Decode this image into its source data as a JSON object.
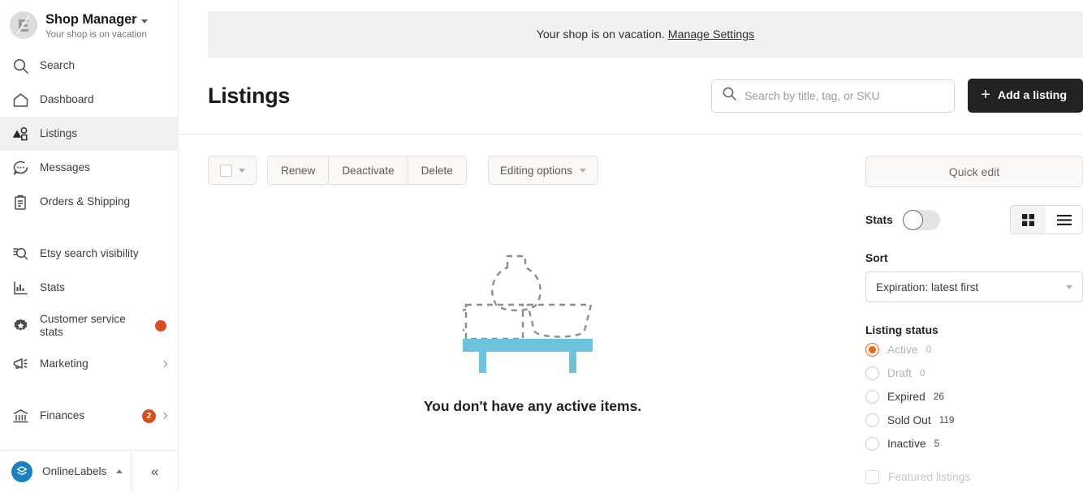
{
  "sidebar": {
    "shop": {
      "title": "Shop Manager",
      "subtitle": "Your shop is on vacation"
    },
    "items": [
      {
        "label": "Search",
        "icon": "search-icon",
        "badge": null,
        "chevron": false
      },
      {
        "label": "Dashboard",
        "icon": "home-icon",
        "badge": null,
        "chevron": false
      },
      {
        "label": "Listings",
        "icon": "listings-icon",
        "badge": null,
        "chevron": false
      },
      {
        "label": "Messages",
        "icon": "message-icon",
        "badge": null,
        "chevron": false
      },
      {
        "label": "Orders & Shipping",
        "icon": "clipboard-icon",
        "badge": null,
        "chevron": false
      },
      {
        "label": "Etsy search visibility",
        "icon": "search-stats-icon",
        "badge": null,
        "chevron": false
      },
      {
        "label": "Stats",
        "icon": "bar-chart-icon",
        "badge": null,
        "chevron": false
      },
      {
        "label": "Customer service stats",
        "icon": "star-badge-icon",
        "badge": "dot",
        "chevron": false
      },
      {
        "label": "Marketing",
        "icon": "megaphone-icon",
        "badge": null,
        "chevron": true
      },
      {
        "label": "Finances",
        "icon": "bank-icon",
        "badge": "2",
        "chevron": true
      }
    ],
    "footer": {
      "shop_name": "OnlineLabels",
      "collapse_label": "«"
    }
  },
  "banner": {
    "text": "Your shop is on vacation.",
    "link_label": "Manage Settings"
  },
  "header": {
    "title": "Listings",
    "search_placeholder": "Search by title, tag, or SKU",
    "search_value": "",
    "add_listing_label": "Add a listing"
  },
  "toolbar": {
    "renew_label": "Renew",
    "deactivate_label": "Deactivate",
    "delete_label": "Delete",
    "editing_options_label": "Editing options"
  },
  "empty_state": {
    "message": "You don't have any active items.",
    "shelf_color": "#6dc2dc",
    "outline_color": "#8d8d8d"
  },
  "right_panel": {
    "quick_edit_label": "Quick edit",
    "stats_label": "Stats",
    "stats_enabled": false,
    "view_grid_label": "grid-view",
    "view_list_label": "list-view",
    "sort_label": "Sort",
    "sort_value": "Expiration: latest first",
    "listing_status_label": "Listing status",
    "statuses": [
      {
        "label": "Active",
        "count": "0",
        "selected": true,
        "disabled": true
      },
      {
        "label": "Draft",
        "count": "0",
        "selected": false,
        "disabled": true
      },
      {
        "label": "Expired",
        "count": "26",
        "selected": false,
        "disabled": false
      },
      {
        "label": "Sold Out",
        "count": "119",
        "selected": false,
        "disabled": false
      },
      {
        "label": "Inactive",
        "count": "5",
        "selected": false,
        "disabled": false
      }
    ],
    "featured_label": "Featured listings",
    "featured_checked": false
  },
  "colors": {
    "accent_orange": "#f1641e",
    "badge_red": "#d94f1e",
    "teal": "#6dc2dc",
    "dark_button": "#222222"
  }
}
